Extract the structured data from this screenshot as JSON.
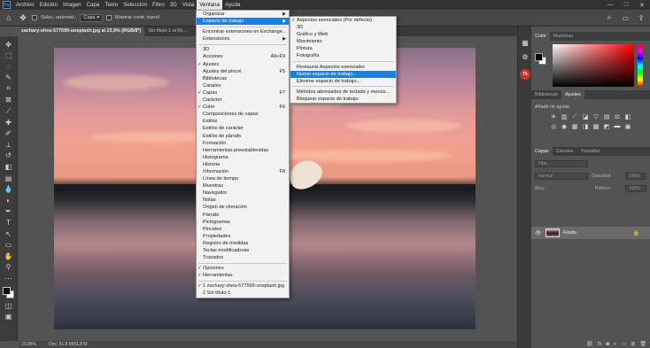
{
  "app": {
    "logo": "Ps",
    "menubar": [
      "Archivo",
      "Edición",
      "Imagen",
      "Capa",
      "Texto",
      "Selección",
      "Filtro",
      "3D",
      "Vista",
      "Ventana",
      "Ayuda"
    ],
    "active_menu": "Ventana",
    "window_controls": [
      "—",
      "□",
      "✕"
    ]
  },
  "options_bar": {
    "auto_select_label": "Selec. automát.:",
    "auto_select_value": "Capa",
    "show_transform_label": "Mostrar contr. transf."
  },
  "tabs": [
    {
      "label": "zachary-shea-577599-unsplash.jpg al 23,9% (RGB/8*)",
      "active": true
    },
    {
      "label": "Sin título-1 al 66,...",
      "active": false
    }
  ],
  "status": {
    "zoom": "23,88%",
    "doc": "Doc: 51,8 M/51,8 M"
  },
  "panels": {
    "color_tabs": [
      "Color",
      "Muestras"
    ],
    "adjust_tabs": [
      "Bibliotecas",
      "Ajustes"
    ],
    "adjust_label": "Añadir un ajuste",
    "layer_tabs": [
      "Capas",
      "Canales",
      "Trazados"
    ],
    "layer_search": "Tipo",
    "blend_mode": "Normal",
    "opacity_label": "Opacidad:",
    "opacity_value": "100%",
    "lock_label": "Bloq.:",
    "fill_label": "Relleno:",
    "fill_value": "100%",
    "layer_name": "Fondo"
  },
  "ventana_menu": [
    {
      "label": "Organizar",
      "arrow": true
    },
    {
      "label": "Espacio de trabajo",
      "arrow": true,
      "highlight": true
    },
    {
      "sep": true
    },
    {
      "label": "Encontrar extensiones en Exchange..."
    },
    {
      "label": "Extensiones",
      "arrow": true
    },
    {
      "sep": true
    },
    {
      "label": "3D"
    },
    {
      "label": "Acciones",
      "shortcut": "Alt+F9"
    },
    {
      "label": "Ajustes",
      "check": true
    },
    {
      "label": "Ajustes del pincel",
      "shortcut": "F5"
    },
    {
      "label": "Bibliotecas"
    },
    {
      "label": "Canales"
    },
    {
      "label": "Capas",
      "shortcut": "F7",
      "check": true
    },
    {
      "label": "Carácter"
    },
    {
      "label": "Color",
      "shortcut": "F6",
      "check": true
    },
    {
      "label": "Composiciones de capas"
    },
    {
      "label": "Estilos"
    },
    {
      "label": "Estilos de carácter"
    },
    {
      "label": "Estilos de párrafo"
    },
    {
      "label": "Formación"
    },
    {
      "label": "Herramientas preestablecidas"
    },
    {
      "label": "Histograma"
    },
    {
      "label": "Historia"
    },
    {
      "label": "Información",
      "shortcut": "F8"
    },
    {
      "label": "Línea de tiempo"
    },
    {
      "label": "Muestras"
    },
    {
      "label": "Navegador"
    },
    {
      "label": "Notas"
    },
    {
      "label": "Origen de clonación"
    },
    {
      "label": "Párrafo"
    },
    {
      "label": "Pictogramas"
    },
    {
      "label": "Pinceles"
    },
    {
      "label": "Propiedades"
    },
    {
      "label": "Registro de medidas"
    },
    {
      "label": "Teclas modificadoras"
    },
    {
      "label": "Trazados"
    },
    {
      "sep": true
    },
    {
      "label": "Opciones",
      "check": true
    },
    {
      "label": "Herramientas",
      "check": true
    },
    {
      "sep": true
    },
    {
      "label": "1 zachary-shea-577599-unsplash.jpg",
      "check": true
    },
    {
      "label": "2 Sin título-1"
    }
  ],
  "workspace_submenu": [
    {
      "label": "Aspectos esenciales (Por defecto)",
      "check": true
    },
    {
      "label": "3D"
    },
    {
      "label": "Gráfico y Web"
    },
    {
      "label": "Movimiento"
    },
    {
      "label": "Pintura"
    },
    {
      "label": "Fotografía"
    },
    {
      "sep": true
    },
    {
      "label": "Restaurar Aspectos esenciales"
    },
    {
      "label": "Nuevo espacio de trabajo...",
      "highlight": true
    },
    {
      "label": "Eliminar espacio de trabajo..."
    },
    {
      "sep": true
    },
    {
      "label": "Métodos abreviados de teclado y menús..."
    },
    {
      "label": "Bloquear espacio de trabajo"
    }
  ]
}
